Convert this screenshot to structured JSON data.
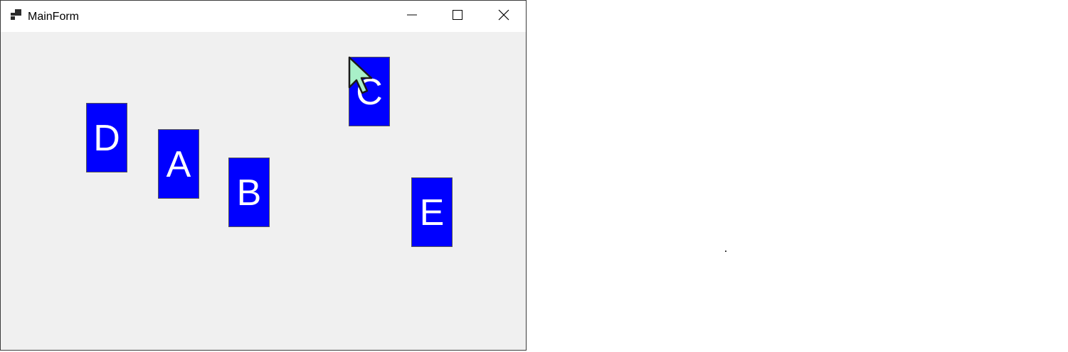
{
  "window": {
    "title": "MainForm",
    "icon": "app-window-icon",
    "controls": {
      "minimize_icon": "minimize-icon",
      "maximize_icon": "maximize-icon",
      "close_icon": "close-icon"
    }
  },
  "cards": {
    "D": "D",
    "A": "A",
    "B": "B",
    "C": "C",
    "E": "E"
  },
  "colors": {
    "card_background": "#0000ff",
    "card_text": "#ffffff",
    "client_background": "#f0f0f0",
    "titlebar_background": "#ffffff",
    "cursor_fill": "#a8f0c8"
  }
}
